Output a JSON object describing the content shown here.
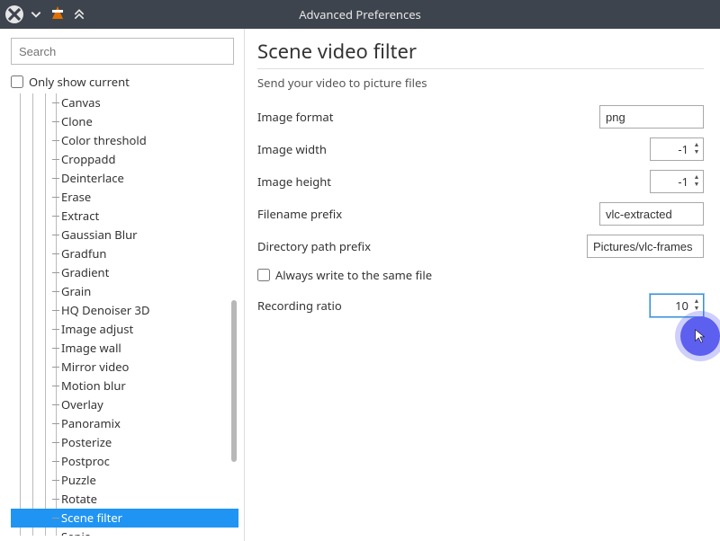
{
  "window": {
    "title": "Advanced Preferences"
  },
  "sidebar": {
    "search_placeholder": "Search",
    "only_show_label": "Only show current",
    "items": [
      "Canvas",
      "Clone",
      "Color threshold",
      "Croppadd",
      "Deinterlace",
      "Erase",
      "Extract",
      "Gaussian Blur",
      "Gradfun",
      "Gradient",
      "Grain",
      "HQ Denoiser 3D",
      "Image adjust",
      "Image wall",
      "Mirror video",
      "Motion blur",
      "Overlay",
      "Panoramix",
      "Posterize",
      "Postproc",
      "Puzzle",
      "Rotate",
      "Scene filter",
      "Sepia"
    ],
    "selected_index": 22
  },
  "pane": {
    "title": "Scene video filter",
    "subtitle": "Send your video to picture files",
    "labels": {
      "image_format": "Image format",
      "image_width": "Image width",
      "image_height": "Image height",
      "filename_prefix": "Filename prefix",
      "directory_prefix": "Directory path prefix",
      "always_same_file": "Always write to the same file",
      "recording_ratio": "Recording ratio"
    },
    "values": {
      "image_format": "png",
      "image_width": "-1",
      "image_height": "-1",
      "filename_prefix": "vlc-extracted",
      "directory_prefix": "Pictures/vlc-frames",
      "always_same_file": false,
      "recording_ratio": "10"
    }
  }
}
